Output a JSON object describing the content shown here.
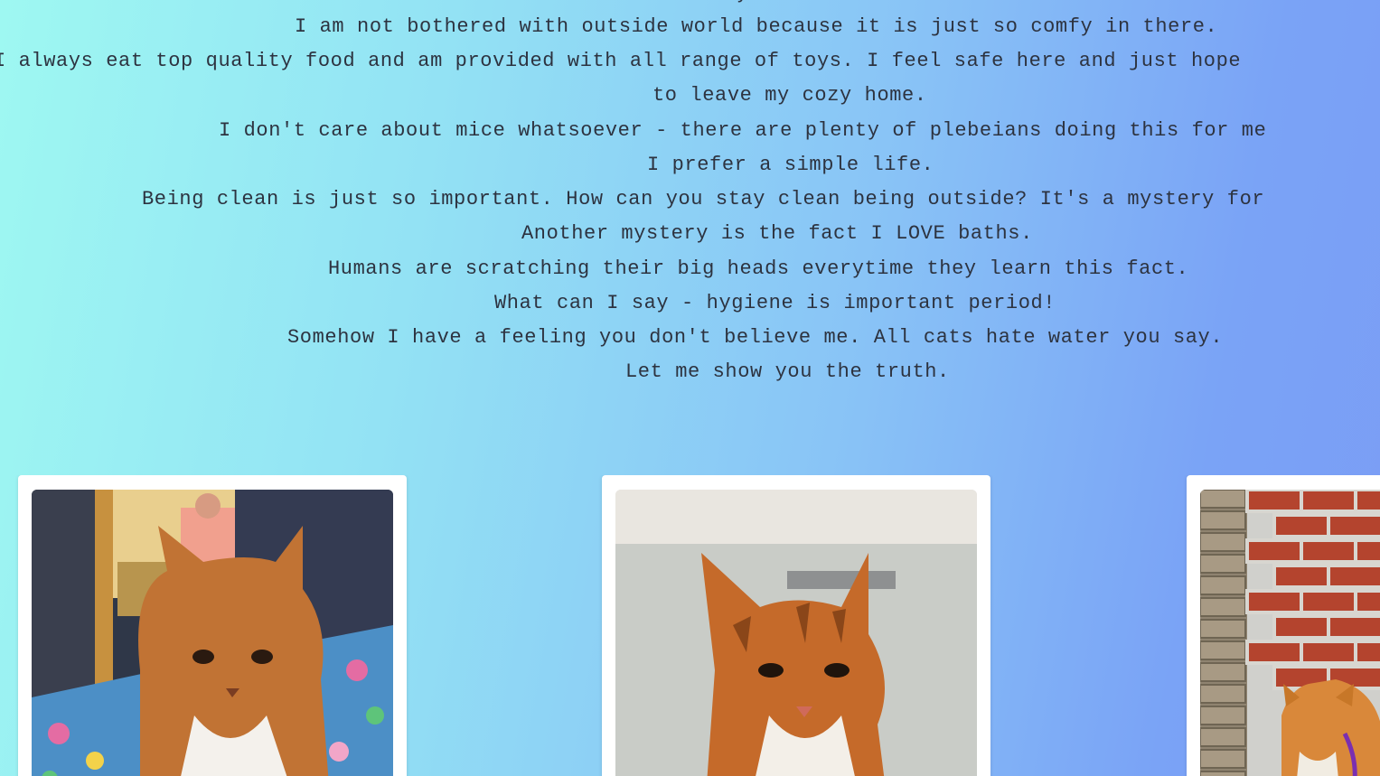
{
  "story": {
    "top_fragment": "y",
    "lines": [
      "I am not bothered with outside world because it is just so comfy in there.",
      "I always eat top quality food and am provided with all range of toys. I feel safe here and just hope",
      "to leave my cozy home.",
      "I don't care about mice whatsoever - there are plenty of plebeians doing this for me",
      "I prefer a simple life.",
      "Being clean is just so important. How can you stay clean being outside? It's a mystery for",
      "Another mystery is the fact I LOVE baths.",
      "Humans are scratching their big heads everytime they learn this fact.",
      "What can I say - hygiene is important period!",
      "Somehow I have a feeling you don't believe me. All cats hate water you say.",
      "Let me show you the truth."
    ]
  },
  "gallery": {
    "photos": [
      {
        "subject": "ginger-white cat on floral blanket in room"
      },
      {
        "subject": "wet ginger cat in bathtub"
      },
      {
        "subject": "ginger cat with purple harness by brick wall"
      }
    ]
  },
  "colors": {
    "gradient_left": "#9ef8f2",
    "gradient_right": "#7b9df5",
    "text": "#2d3340",
    "card": "#ffffff"
  }
}
